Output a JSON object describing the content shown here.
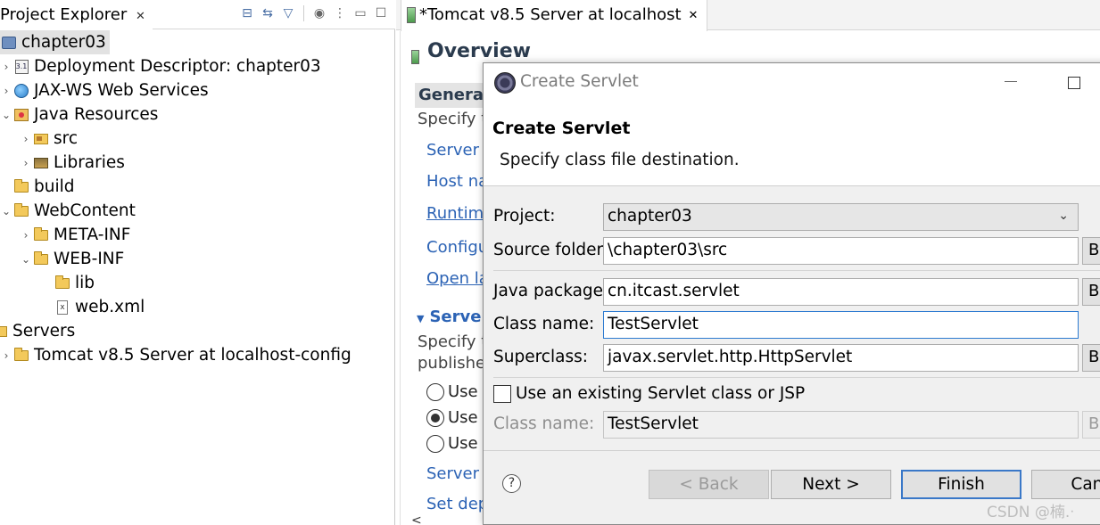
{
  "explorer": {
    "tab_label": "Project Explorer",
    "close_glyph": "✕",
    "tree": [
      {
        "label": "chapter03",
        "selected": true
      },
      {
        "label": "Deployment Descriptor: chapter03"
      },
      {
        "label": "JAX-WS Web Services"
      },
      {
        "label": "Java Resources"
      },
      {
        "label": "src"
      },
      {
        "label": "Libraries"
      },
      {
        "label": "build"
      },
      {
        "label": "WebContent"
      },
      {
        "label": "META-INF"
      },
      {
        "label": "WEB-INF"
      },
      {
        "label": "lib"
      },
      {
        "label": "web.xml"
      },
      {
        "label": "Servers"
      },
      {
        "label": "Tomcat v8.5 Server at localhost-config"
      }
    ]
  },
  "editor": {
    "tab_label": "*Tomcat v8.5 Server at localhost",
    "close_glyph": "✕",
    "overview_title": "Overview",
    "general_head": "General",
    "specify_1": "Specify t",
    "links": [
      "Server n",
      "Host na",
      "Runtim",
      "Configu",
      "Open la"
    ],
    "server_head": "Server",
    "specify_2": "Specify t",
    "published": "publishe",
    "radios": [
      "Use v",
      "Use T",
      "Use c"
    ],
    "server_p": "Server p",
    "set_dep": "Set dep"
  },
  "dialog": {
    "window_title": "Create Servlet",
    "banner_title": "Create Servlet",
    "banner_desc": "Specify class file destination.",
    "project_label": "Project:",
    "project_value": "chapter03",
    "source_label": "Source folder:",
    "source_value": "\\chapter03\\src",
    "package_label": "Java package:",
    "package_value": "cn.itcast.servlet",
    "class_label": "Class name:",
    "class_value": "TestServlet",
    "super_label": "Superclass:",
    "super_value": "javax.servlet.http.HttpServlet",
    "browse_label": "Br",
    "existing_label": "Use an existing Servlet class or JSP",
    "existing_class_label": "Class name:",
    "existing_class_value": "TestServlet",
    "help_glyph": "?",
    "back_label": "< Back",
    "next_label": "Next >",
    "finish_label": "Finish",
    "cancel_label": "Canc"
  },
  "watermark": "CSDN @楠.ᐧ"
}
